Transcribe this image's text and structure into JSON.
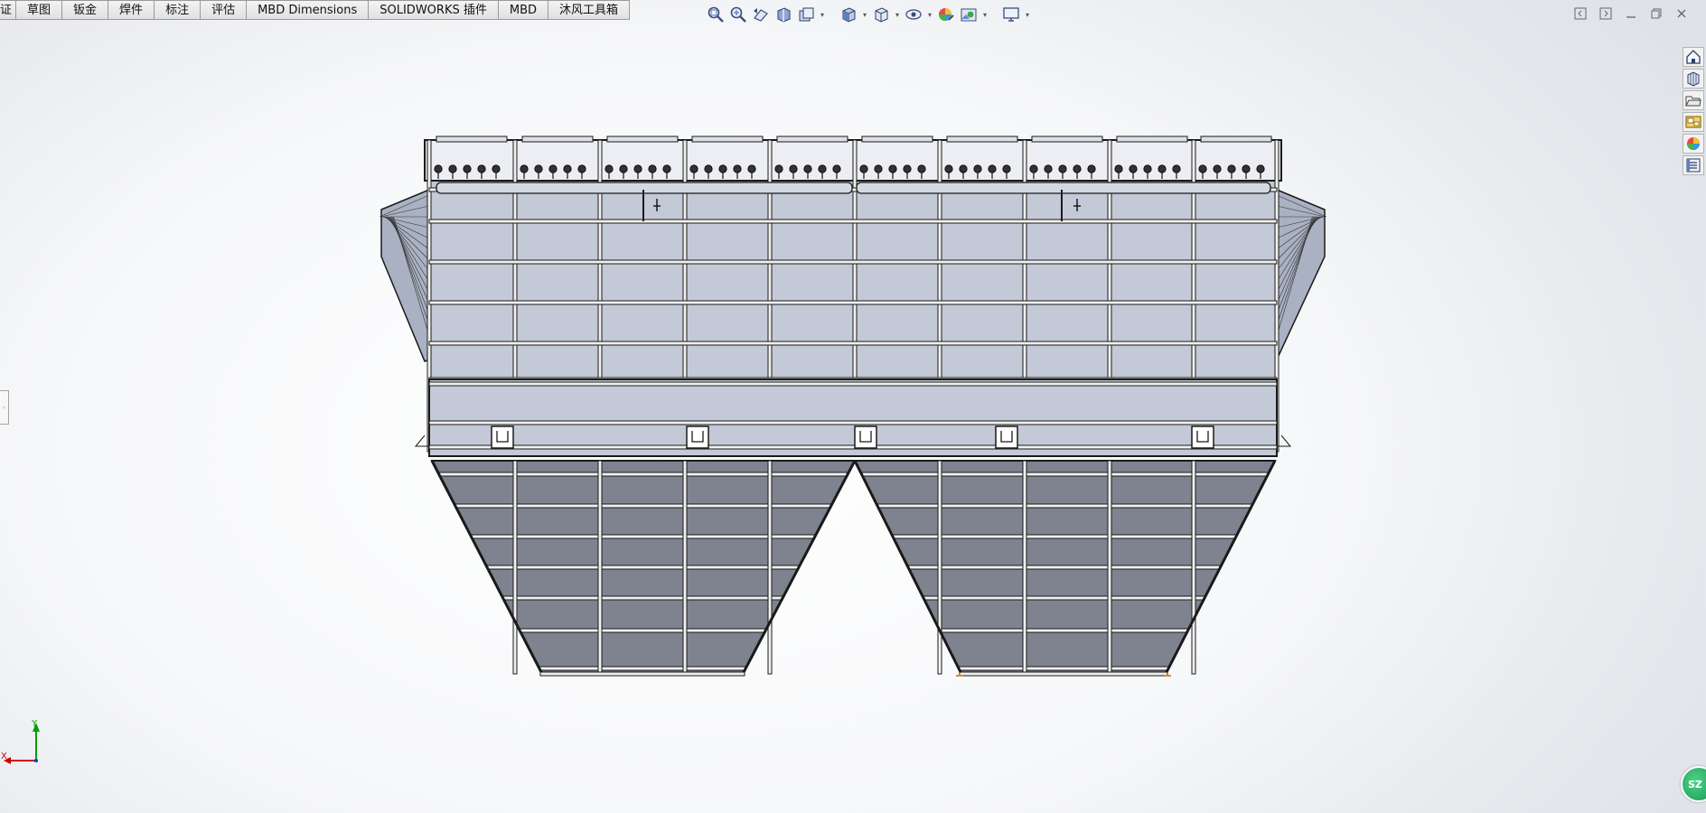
{
  "tabs": [
    "证",
    "草图",
    "钣金",
    "焊件",
    "标注",
    "评估",
    "MBD Dimensions",
    "SOLIDWORKS 插件",
    "MBD",
    "沐风工具箱"
  ],
  "hud_icons": [
    "zoom-to-fit-icon",
    "zoom-to-area-icon",
    "previous-view-icon",
    "section-view-icon",
    "dynamic-annotation-icon",
    "view-orientation-icon",
    "display-style-icon",
    "hide-show-items-icon",
    "edit-appearance-icon",
    "apply-scene-icon",
    "view-settings-icon"
  ],
  "window_controls": [
    "tile-left-icon",
    "tile-right-icon",
    "minimize-icon",
    "restore-icon",
    "close-icon"
  ],
  "task_pane": [
    "solidworks-resources-icon",
    "design-library-icon",
    "file-explorer-icon",
    "view-palette-icon",
    "appearances-scenes-icon",
    "custom-properties-icon"
  ],
  "triad": {
    "x_label": "X",
    "y_label": "Y"
  },
  "badge": {
    "label": "SZ"
  },
  "colors": {
    "upper_panel": "#c3c9d6",
    "lower_hopper": "#7e838f",
    "frame": "#1a1a1a",
    "triad_x": "#d00000",
    "triad_y": "#00a000"
  }
}
